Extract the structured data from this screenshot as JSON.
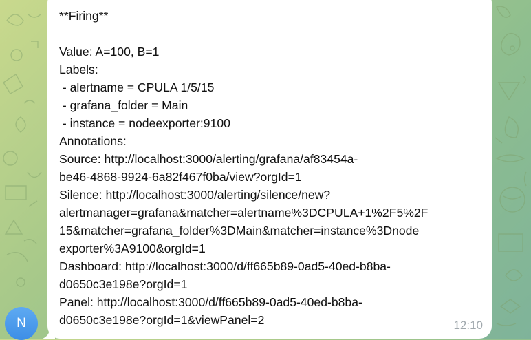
{
  "chat": {
    "avatar_initial": "N",
    "message_lines": [
      "**Firing**",
      "",
      "Value: A=100, B=1",
      "Labels:",
      " - alertname = CPULA 1/5/15",
      " - grafana_folder = Main",
      " - instance = nodeexporter:9100",
      "Annotations:",
      "Source: http://localhost:3000/alerting/grafana/af83454a-",
      "be46-4868-9924-6a82f467f0ba/view?orgId=1",
      "Silence: http://localhost:3000/alerting/silence/new?",
      "alertmanager=grafana&matcher=alertname%3DCPULA+1%2F5%2F",
      "15&matcher=grafana_folder%3DMain&matcher=instance%3Dnode",
      "exporter%3A9100&orgId=1",
      "Dashboard: http://localhost:3000/d/ff665b89-0ad5-40ed-b8ba-",
      "d0650c3e198e?orgId=1",
      "Panel: http://localhost:3000/d/ff665b89-0ad5-40ed-b8ba-",
      "d0650c3e198e?orgId=1&viewPanel=2"
    ],
    "time": "12:10"
  },
  "colors": {
    "bubble": "#ffffff",
    "avatar": "#4a9bea",
    "time": "#a0a8ad"
  }
}
